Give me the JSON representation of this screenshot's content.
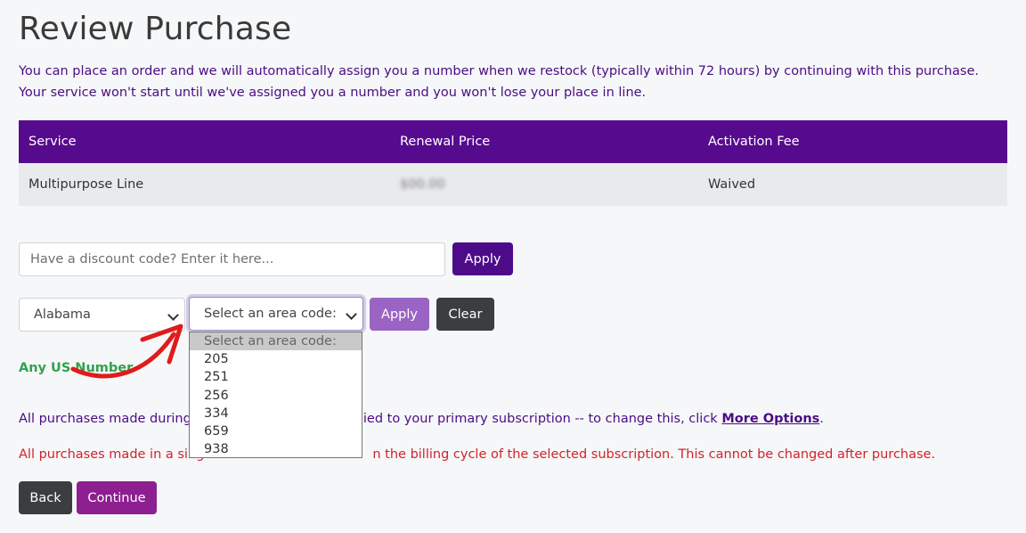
{
  "page": {
    "title": "Review Purchase",
    "intro": "You can place an order and we will automatically assign you a number when we restock (typically within 72 hours) by continuing with this purchase. Your service won't start until we've assigned you a number and you won't lose your place in line."
  },
  "table": {
    "headers": [
      "Service",
      "Renewal Price",
      "Activation Fee"
    ],
    "row": {
      "service": "Multipurpose Line",
      "renewal_price": "$00.00",
      "activation_fee": "Waived"
    }
  },
  "discount": {
    "placeholder": "Have a discount code? Enter it here...",
    "apply_label": "Apply"
  },
  "area_filter": {
    "state_selected": "Alabama",
    "area_code_selected": "Select an area code:",
    "apply_label": "Apply",
    "clear_label": "Clear",
    "options": [
      "Select an area code:",
      "205",
      "251",
      "256",
      "334",
      "659",
      "938"
    ]
  },
  "any_us_number": "Any US Number",
  "info_text_before": "All purchases made during",
  "info_text_after": "lied to your primary subscription -- to change this, click",
  "info_link": "More Options",
  "info_period": ".",
  "warning_before": "All purchases made in a sing",
  "warning_after": "n the billing cycle of the selected subscription. This cannot be changed after purchase.",
  "buttons": {
    "back": "Back",
    "continue": "Continue"
  },
  "colors": {
    "accent_purple": "#560b8e",
    "continue_magenta": "#8d1f90",
    "success_green": "#31a24c",
    "warning_red": "#d0232a",
    "annotation_arrow": "#e01b1b"
  }
}
